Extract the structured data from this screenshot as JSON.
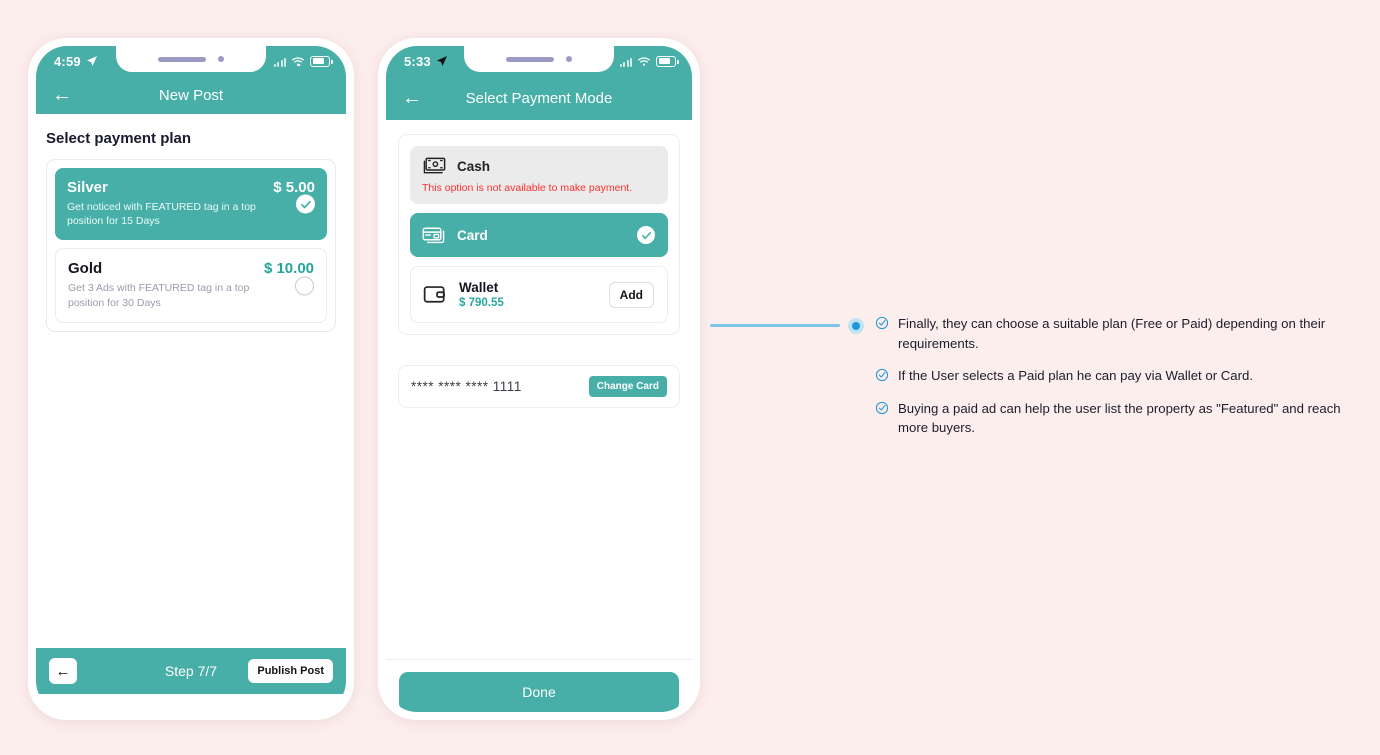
{
  "background_color": "#fdeeee",
  "accent_color": "#47afa8",
  "connector_color": "#7ec4e8",
  "phone1": {
    "statusbar": {
      "time": "4:59",
      "location_icon": "location-arrow-icon",
      "signal_icon": "signal-bars-icon",
      "wifi_icon": "wifi-icon",
      "battery_icon": "battery-icon"
    },
    "navbar": {
      "back_icon": "←",
      "title": "New Post"
    },
    "section_title": "Select payment plan",
    "plans": [
      {
        "name": "Silver",
        "price": "$ 5.00",
        "description": "Get noticed with FEATURED tag in a top position for 15 Days",
        "selected": true
      },
      {
        "name": "Gold",
        "price": "$ 10.00",
        "description": "Get 3 Ads with FEATURED tag in a top position for 30 Days",
        "selected": false
      }
    ],
    "bottom_bar": {
      "back_icon": "←",
      "step_label": "Step 7/7",
      "publish_label": "Publish Post"
    }
  },
  "phone2": {
    "statusbar": {
      "time": "5:33",
      "location_icon": "location-arrow-icon",
      "signal_icon": "signal-bars-icon",
      "wifi_icon": "wifi-icon",
      "battery_icon": "battery-icon"
    },
    "navbar": {
      "back_icon": "←",
      "title": "Select Payment Mode"
    },
    "options": {
      "cash": {
        "label": "Cash",
        "icon": "cash-icon",
        "note": "This option is not available to make payment."
      },
      "card": {
        "label": "Card",
        "icon": "credit-card-icon",
        "selected": true
      },
      "wallet": {
        "label": "Wallet",
        "icon": "wallet-icon",
        "balance": "$ 790.55",
        "add_label": "Add"
      }
    },
    "saved_card": {
      "number": "**** **** **** 1111",
      "change_label": "Change Card"
    },
    "done_label": "Done"
  },
  "annotation": {
    "notes": [
      "Finally, they can choose a suitable plan (Free or Paid) depending on their requirements.",
      "If the User selects a Paid plan he can pay via Wallet or Card.",
      "Buying a paid ad can help the user list the property as \"Featured\" and reach more buyers."
    ]
  }
}
